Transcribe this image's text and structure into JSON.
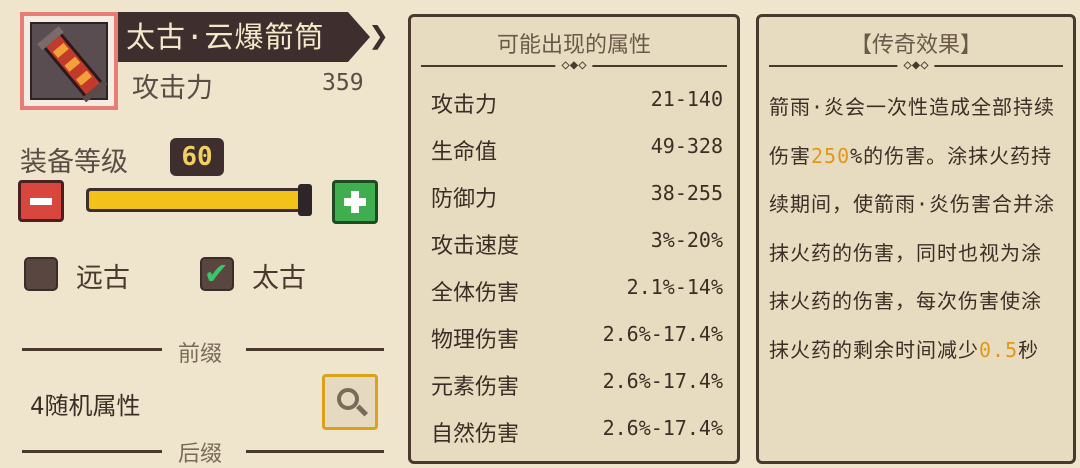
{
  "item": {
    "icon": "quiver-icon",
    "name": "太古·云爆箭筒",
    "attack_label": "攻击力",
    "attack_value": "359"
  },
  "level": {
    "label": "装备等级",
    "value": "60",
    "fill_fraction": 1.0
  },
  "rarity_options": [
    {
      "label": "远古",
      "checked": false
    },
    {
      "label": "太古",
      "checked": true
    }
  ],
  "prefix": {
    "label": "前缀",
    "text": "4随机属性"
  },
  "suffix": {
    "label": "后缀"
  },
  "stats_panel": {
    "title": "可能出现的属性",
    "rows": [
      {
        "name": "攻击力",
        "value": "21-140"
      },
      {
        "name": "生命值",
        "value": "49-328"
      },
      {
        "name": "防御力",
        "value": "38-255"
      },
      {
        "name": "攻击速度",
        "value": "3%-20%"
      },
      {
        "name": "全体伤害",
        "value": "2.1%-14%"
      },
      {
        "name": "物理伤害",
        "value": "2.6%-17.4%"
      },
      {
        "name": "元素伤害",
        "value": "2.6%-17.4%"
      },
      {
        "name": "自然伤害",
        "value": "2.6%-17.4%"
      }
    ]
  },
  "legend_panel": {
    "title": "【传奇效果】",
    "text_1": "箭雨·炎会一次性造成全部持续伤害",
    "highlight_1": "250",
    "text_2": "%的伤害。涂抹火药持续期间，使箭雨·炎伤害合并涂抹火药的伤害，同时也视为涂抹火药的伤害，每次伤害使涂抹火药的剩余时间减少",
    "highlight_2": "0.5",
    "text_3": "秒"
  },
  "colors": {
    "background": "#efe5cc",
    "panel": "#e8dcc0",
    "highlight": "#e0981c",
    "slider_fill": "#f2c21b",
    "minus_button": "#d9463e",
    "plus_button": "#3fae4e"
  }
}
